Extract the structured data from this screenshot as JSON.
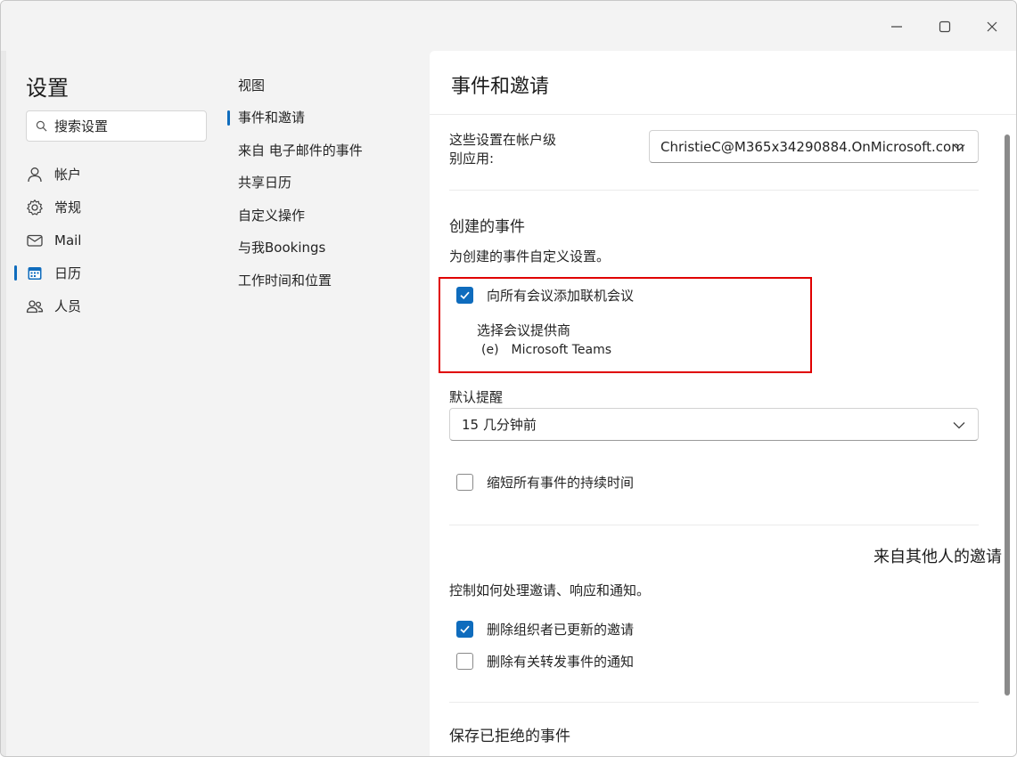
{
  "settings": {
    "title": "设置",
    "search_placeholder": "搜索设置"
  },
  "nav": {
    "items": [
      {
        "label": "帐户",
        "icon": "person-icon"
      },
      {
        "label": "常规",
        "icon": "gear-icon"
      },
      {
        "label": "Mail",
        "icon": "mail-icon"
      },
      {
        "label": "日历",
        "icon": "calendar-icon"
      },
      {
        "label": "人员",
        "icon": "people-icon"
      }
    ],
    "active_index": 3
  },
  "subnav": {
    "items": [
      {
        "label": "视图"
      },
      {
        "label": "事件和邀请"
      },
      {
        "label": "来自 电子邮件的事件"
      },
      {
        "label": "共享日历"
      },
      {
        "label": "自定义操作"
      },
      {
        "label": "与我Bookings"
      },
      {
        "label": "工作时间和位置"
      }
    ],
    "active_index": 1
  },
  "main": {
    "title": "事件和邀请",
    "account": {
      "label": "这些设置在帐户级别应用:",
      "value": "ChristieC@M365x34290884.OnMicrosoft.com"
    },
    "created_events": {
      "title": "创建的事件",
      "description": "为创建的事件自定义设置。",
      "add_online_meeting": {
        "label": "向所有会议添加联机会议",
        "checked": true
      },
      "provider_label": "选择会议提供商",
      "provider_radio": "(e)",
      "provider_value": "Microsoft Teams",
      "reminder_label": "默认提醒",
      "reminder_value": "15 几分钟前",
      "shorten_events": {
        "label": "缩短所有事件的持续时间",
        "checked": false
      }
    },
    "invitations": {
      "title": "来自其他人的邀请",
      "description": "控制如何处理邀请、响应和通知。",
      "delete_updated": {
        "label": "删除组织者已更新的邀请",
        "checked": true
      },
      "delete_forward": {
        "label": "删除有关转发事件的通知",
        "checked": false
      }
    },
    "declined": {
      "title": "保存已拒绝的事件"
    }
  },
  "colors": {
    "accent": "#0f6cbd",
    "highlight": "#e00000"
  }
}
